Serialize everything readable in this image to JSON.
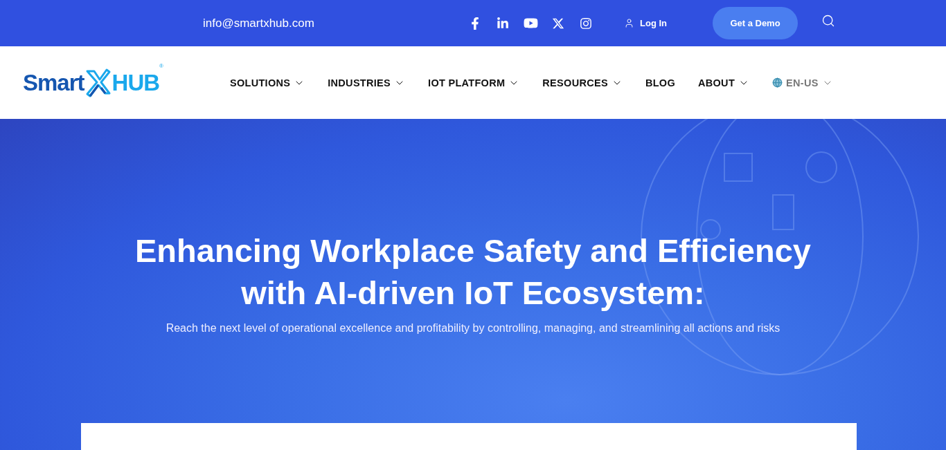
{
  "top_bar": {
    "email": "info@smartxhub.com",
    "login": "Log In",
    "demo_button": "Get a Demo"
  },
  "header": {
    "logo": {
      "left": "Smart",
      "right": "HUB",
      "mark": "®"
    },
    "nav": [
      {
        "label": "SOLUTIONS",
        "kind": "dropdown"
      },
      {
        "label": "INDUSTRIES",
        "kind": "dropdown"
      },
      {
        "label": "IOT PLATFORM",
        "kind": "dropdown"
      },
      {
        "label": "RESOURCES",
        "kind": "dropdown"
      },
      {
        "label": "BLOG",
        "kind": "link"
      },
      {
        "label": "ABOUT",
        "kind": "dropdown"
      },
      {
        "label": "EN-US",
        "kind": "language"
      }
    ]
  },
  "hero": {
    "title_lines": [
      "Enhancing Workplace Safety and Efficiency",
      "with AI-driven IoT Ecosystem:"
    ],
    "subtitle": "Reach the next level of operational excellence and profitability by controlling, managing, and streamlining all actions and risks"
  }
}
